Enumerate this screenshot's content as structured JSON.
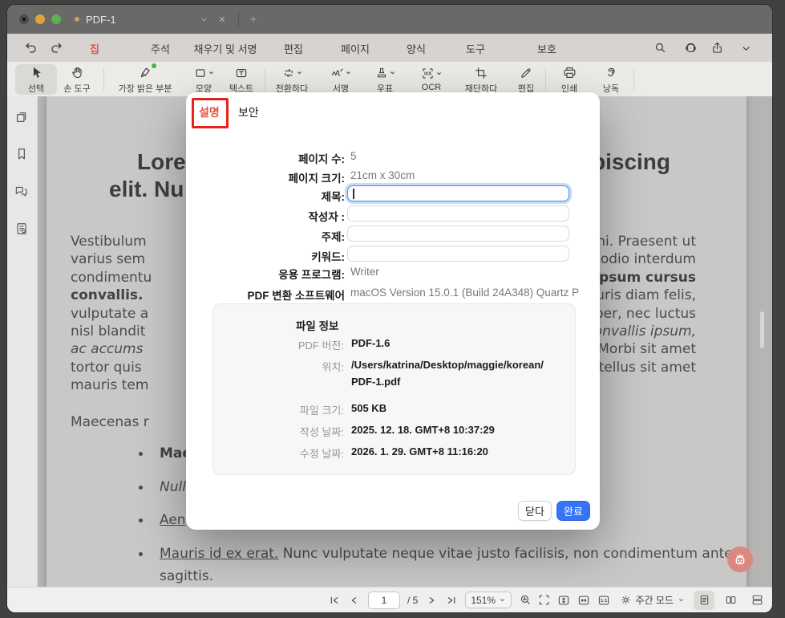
{
  "window": {
    "tab_title": "PDF-1"
  },
  "ribbon": {
    "tabs": [
      {
        "label": "집"
      },
      {
        "label": "주석"
      },
      {
        "label": "채우기 및 서명"
      },
      {
        "label": "편집"
      },
      {
        "label": "페이지"
      },
      {
        "label": "양식"
      },
      {
        "label": "도구"
      },
      {
        "label": "보호"
      }
    ],
    "active_tab": "집",
    "accent_color": "#e0564b"
  },
  "toolbar": {
    "tools": [
      {
        "label": "선택"
      },
      {
        "label": "손 도구"
      },
      {
        "label": "가장 밝은 부분"
      },
      {
        "label": "모양"
      },
      {
        "label": "텍스트"
      },
      {
        "label": "전환하다"
      },
      {
        "label": "서명"
      },
      {
        "label": "우표"
      },
      {
        "label": "OCR"
      },
      {
        "label": "재단하다"
      },
      {
        "label": "편집"
      },
      {
        "label": "인쇄"
      },
      {
        "label": "낭독"
      }
    ]
  },
  "document": {
    "heading": {
      "left_line1": "Lore",
      "left_line2": "elit. Nu",
      "right_line1": "piscing"
    },
    "left_lines": [
      "Vestibulum",
      "varius sem",
      "condimentu",
      "convallis.",
      "vulputate a",
      "nisl blandit",
      "ac accums",
      "tortor quis",
      "mauris tem"
    ],
    "right_lines": [
      "ni. Praesent ut",
      "odio interdum",
      "psum cursus",
      "uris diam felis,",
      "per, nec luctus",
      "onvallis ipsum,",
      "Morbi sit amet",
      "tellus sit amet"
    ],
    "para2": "Maecenas r",
    "bullets": [
      "Mae",
      "Null",
      "Aen"
    ],
    "bullet4": {
      "underlined": "Mauris id ex erat.",
      "rest": " Nunc vulputate neque vitae justo facilisis, non condimentum ante",
      "line2": "sagittis."
    }
  },
  "dialog": {
    "tabs": {
      "description": "설명",
      "security": "보안"
    },
    "fields": {
      "page_count_label": "페이지 수:",
      "page_count_value": "5",
      "page_size_label": "페이지 크기:",
      "page_size_value": "21cm x 30cm",
      "title_label": "제목:",
      "author_label": "작성자 :",
      "subject_label": "주제:",
      "keywords_label": "키워드:",
      "app_label": "응용 프로그램:",
      "app_value": "Writer",
      "producer_label": "PDF 변환 소프트웨어",
      "producer_value": "macOS Version 15.0.1 (Build 24A348) Quartz P"
    },
    "file_info": {
      "title": "파일 정보",
      "version_label": "PDF 버전:",
      "version_value": "PDF-1.6",
      "location_label": "위치:",
      "location_value_line1": "/Users/katrina/Desktop/maggie/korean/",
      "location_value_line2": "PDF-1.pdf",
      "size_label": "파일 크기:",
      "size_value": "505 KB",
      "created_label": "작성 날짜:",
      "created_value": "2025. 12. 18. GMT+8 10:37:29",
      "modified_label": "수정 날짜:",
      "modified_value": "2026. 1. 29. GMT+8 11:16:20"
    },
    "buttons": {
      "close": "닫다",
      "done": "완료"
    },
    "accent_blue": "#3574f5",
    "annotation_red": "#e8231a"
  },
  "statusbar": {
    "page_value": "1",
    "page_total": "/ 5",
    "zoom_value": "151%",
    "mode_label": "주간 모드"
  }
}
